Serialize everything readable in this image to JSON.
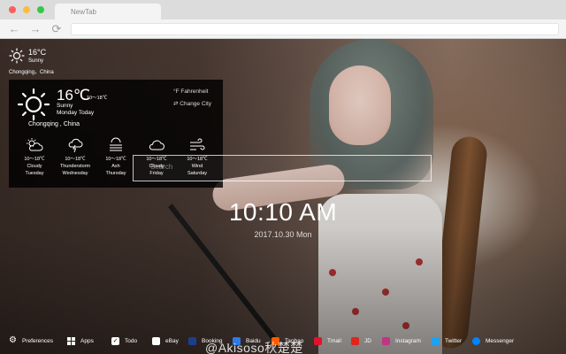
{
  "browser": {
    "tab_title": "NewTab",
    "traffic_colors": [
      "#fc605c",
      "#fdbc40",
      "#34c84a"
    ]
  },
  "weather_small": {
    "temp": "16°C",
    "condition": "Sunny",
    "city": "Chongqing，China"
  },
  "weather_panel": {
    "temp": "16℃",
    "range": "10～18℃",
    "condition": "Sunny",
    "day": "Monday Today",
    "city": "Chongqing , China",
    "fahrenheit_label": "Fahrenheit",
    "change_city_label": "Change City",
    "forecast": [
      {
        "icon": "cloudy-sun-icon",
        "range": "10～18℃",
        "condition": "Cloudy",
        "day": "Tuesday"
      },
      {
        "icon": "thunderstorm-icon",
        "range": "10～18℃",
        "condition": "Thunderstorm",
        "day": "Wednesday"
      },
      {
        "icon": "ash-icon",
        "range": "10～18℃",
        "condition": "Ash",
        "day": "Thursday"
      },
      {
        "icon": "cloud-icon",
        "range": "10～18℃",
        "condition": "Cloudy",
        "day": "Friday"
      },
      {
        "icon": "wind-icon",
        "range": "10～18℃",
        "condition": "Wind",
        "day": "Saturday"
      }
    ]
  },
  "search": {
    "placeholder": "Search"
  },
  "clock": {
    "time": "10:10 AM",
    "date": "2017.10.30 Mon"
  },
  "bottom_bar": {
    "items": [
      {
        "label": "Preferences",
        "icon": "gear-icon",
        "color": "#ffffff"
      },
      {
        "label": "Apps",
        "icon": "grid-icon",
        "color": "#ffffff"
      },
      {
        "label": "Todo",
        "icon": "checkbox-icon",
        "color": "#ffffff"
      },
      {
        "label": "eBay",
        "icon": "ebay-icon",
        "color": "#ffffff"
      },
      {
        "label": "Booking",
        "icon": "booking-icon",
        "color": "#1b3e91"
      },
      {
        "label": "Baidu",
        "icon": "baidu-icon",
        "color": "#2c7be5"
      },
      {
        "label": "Taobao",
        "icon": "taobao-icon",
        "color": "#ff5a00"
      },
      {
        "label": "Tmall",
        "icon": "tmall-icon",
        "color": "#e0122d"
      },
      {
        "label": "JD",
        "icon": "jd-icon",
        "color": "#e1251b"
      },
      {
        "label": "Instagram",
        "icon": "instagram-icon",
        "color": "#c13584"
      },
      {
        "label": "Twitter",
        "icon": "twitter-icon",
        "color": "#1da1f2"
      },
      {
        "label": "Messenger",
        "icon": "messenger-icon",
        "color": "#0084ff"
      }
    ]
  },
  "watermark": "@Akisoso秋楚楚"
}
